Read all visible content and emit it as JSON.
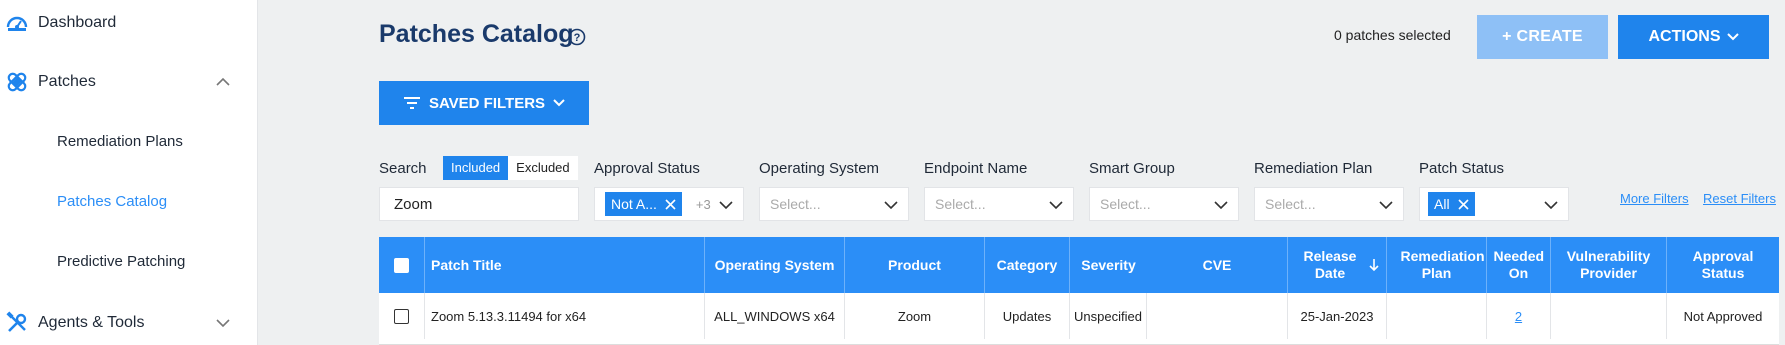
{
  "sidebar": {
    "items": [
      {
        "label": "Dashboard",
        "icon": "gauge-icon"
      },
      {
        "label": "Patches",
        "icon": "bandage-icon",
        "expanded": true
      },
      {
        "label": "Agents & Tools",
        "icon": "tools-icon",
        "expanded": false
      }
    ],
    "sub_items": [
      {
        "label": "Remediation Plans",
        "active": false
      },
      {
        "label": "Patches Catalog",
        "active": true
      },
      {
        "label": "Predictive Patching",
        "active": false
      }
    ]
  },
  "header": {
    "title": "Patches Catalog",
    "selected_count": "0 patches selected",
    "create_label": "+ CREATE",
    "actions_label": "ACTIONS",
    "saved_filters_label": "SAVED FILTERS"
  },
  "filters": {
    "search_label": "Search",
    "toggle_included": "Included",
    "toggle_excluded": "Excluded",
    "search_value": "Zoom",
    "approval_label": "Approval Status",
    "approval_chip": "Not A...",
    "approval_more": "+3",
    "os_label": "Operating System",
    "os_placeholder": "Select...",
    "endpoint_label": "Endpoint Name",
    "endpoint_placeholder": "Select...",
    "smartgroup_label": "Smart Group",
    "smartgroup_placeholder": "Select...",
    "remplan_label": "Remediation Plan",
    "remplan_placeholder": "Select...",
    "status_label": "Patch Status",
    "status_chip": "All",
    "more_filters": "More Filters",
    "reset_filters": "Reset Filters"
  },
  "table": {
    "columns": [
      "Patch Title",
      "Operating System",
      "Product",
      "Category",
      "Severity",
      "CVE",
      "Release Date",
      "Remediation Plan",
      "Needed On",
      "Vulnerability Provider",
      "Approval Status"
    ],
    "sorted_column": "Release Date",
    "sort_direction": "descending",
    "rows": [
      {
        "title": "Zoom 5.13.3.11494 for x64",
        "os": "ALL_WINDOWS x64",
        "product": "Zoom",
        "category": "Updates",
        "severity": "Unspecified",
        "cve": "",
        "release_date": "25-Jan-2023",
        "remediation_plan": "",
        "needed_on": "2",
        "vuln_provider": "",
        "approval_status": "Not Approved"
      }
    ]
  },
  "colors": {
    "primary": "#1f84ec",
    "header_bg": "#2b8ef7",
    "create_disabled": "#8ec0f6",
    "title": "#1a3a6b",
    "link": "#2b8ef7"
  }
}
